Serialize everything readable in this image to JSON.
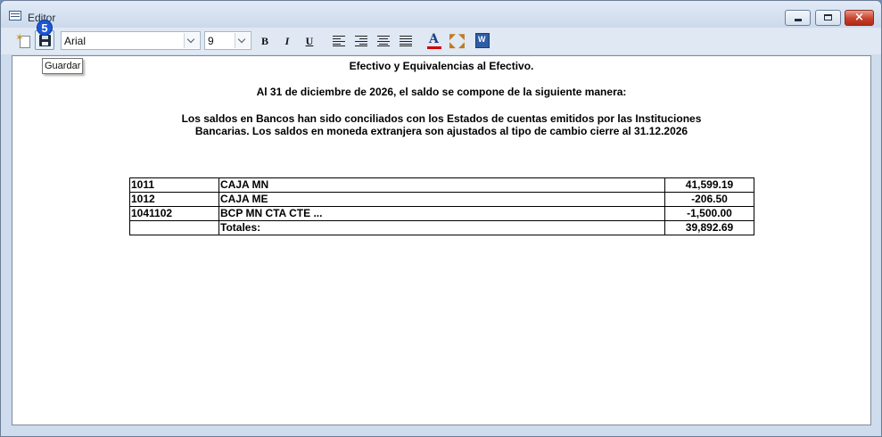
{
  "window": {
    "title": "Editor",
    "buttons": {
      "minimize": "minimize",
      "maximize": "maximize",
      "close": "×"
    }
  },
  "toolbar": {
    "font_name": "Arial",
    "font_size": "9",
    "bold_label": "B",
    "italic_label": "I",
    "underline_label": "U",
    "font_color_label": "A",
    "font_color": "#d40000",
    "word_label": "W",
    "save_badge": "5",
    "save_tooltip": "Guardar"
  },
  "document": {
    "title": "Efectivo y Equivalencias al Efectivo.",
    "subtitle": "Al 31 de diciembre de 2026, el saldo se compone de la siguiente manera:",
    "paragraph_line1": "Los saldos en Bancos han sido conciliados con los Estados de cuentas emitidos por las Instituciones",
    "paragraph_line2": "Bancarias. Los saldos en moneda extranjera son ajustados al tipo de cambio cierre al 31.12.2026",
    "table": {
      "rows": [
        {
          "code": "1011",
          "name": "CAJA MN",
          "amount": "41,599.19"
        },
        {
          "code": "1012",
          "name": "CAJA ME",
          "amount": "-206.50"
        },
        {
          "code": "1041102",
          "name": "BCP MN CTA CTE ...",
          "amount": "-1,500.00"
        }
      ],
      "total_label": "Totales:",
      "total_amount": "39,892.69"
    }
  }
}
